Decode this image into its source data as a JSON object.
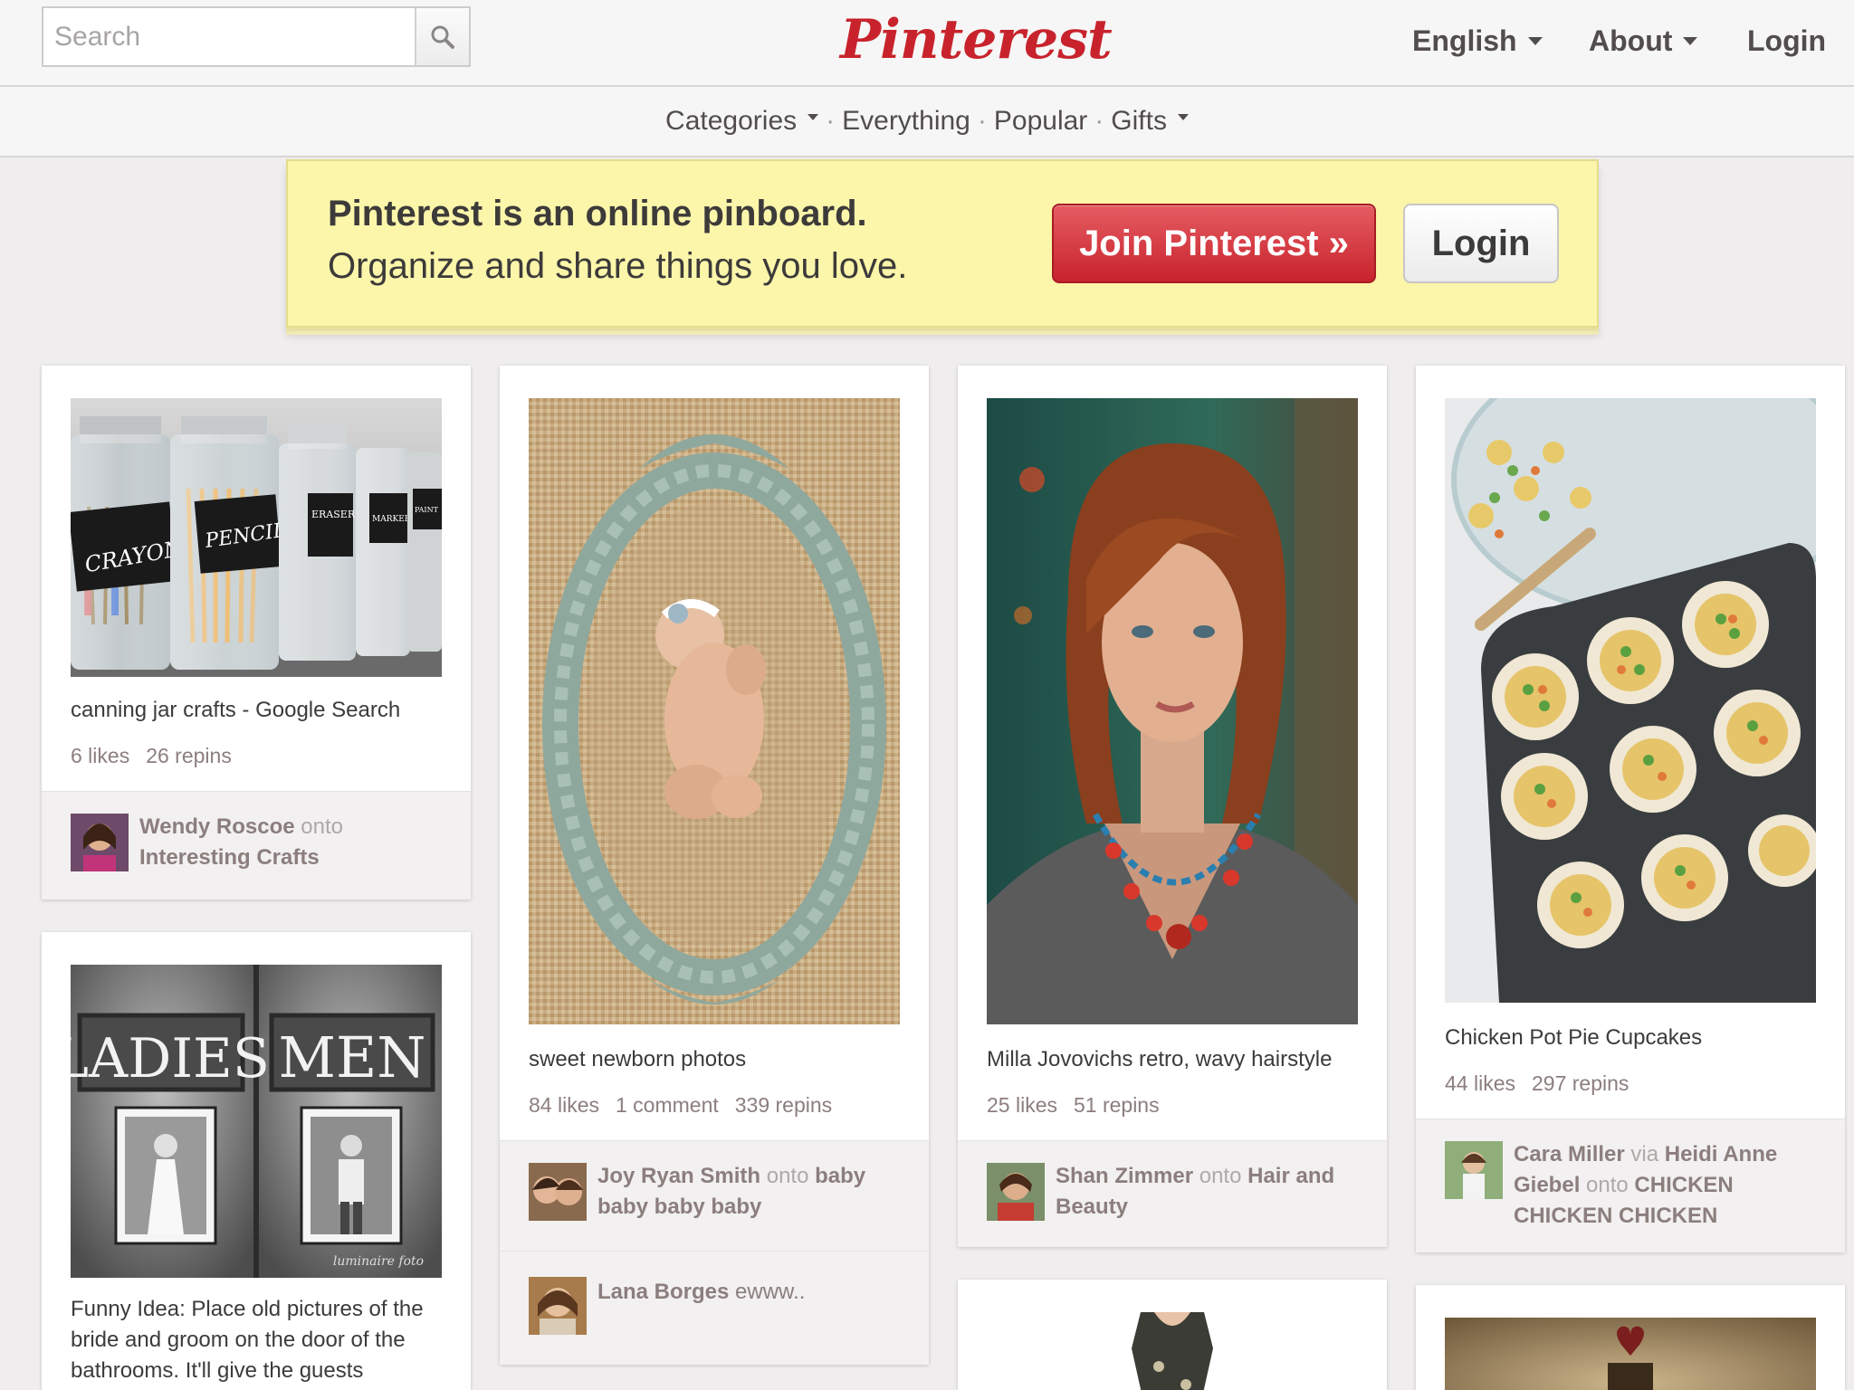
{
  "header": {
    "search_placeholder": "Search",
    "logo": "Pinterest",
    "nav": [
      "English",
      "About",
      "Login"
    ]
  },
  "subnav": {
    "items": [
      "Categories",
      "Everything",
      "Popular",
      "Gifts"
    ]
  },
  "banner": {
    "title": "Pinterest is an online pinboard.",
    "subtitle": "Organize and share things you love.",
    "join_label": "Join Pinterest »",
    "login_label": "Login"
  },
  "pins": [
    {
      "description": "canning jar crafts - Google Search",
      "stats": [
        "6 likes",
        "26 repins"
      ],
      "jar_labels": [
        "CRAYONS",
        "PENCILS",
        "ERASERS SANDS",
        "MARKERS",
        "PAINT"
      ],
      "attribution": [
        {
          "user": "Wendy Roscoe",
          "joiner": "onto",
          "board": "Interesting Crafts"
        }
      ]
    },
    {
      "description": "sweet newborn photos",
      "stats": [
        "84 likes",
        "1 comment",
        "339 repins"
      ],
      "attribution": [
        {
          "user": "Joy Ryan Smith",
          "joiner": "onto",
          "board": "baby baby baby baby"
        },
        {
          "user": "Lana Borges",
          "comment": "ewww.."
        }
      ]
    },
    {
      "description": "Milla Jovovichs retro, wavy hairstyle",
      "stats": [
        "25 likes",
        "51 repins"
      ],
      "attribution": [
        {
          "user": "Shan Zimmer",
          "joiner": "onto",
          "board": "Hair and Beauty"
        }
      ]
    },
    {
      "description": "Chicken Pot Pie Cupcakes",
      "stats": [
        "44 likes",
        "297 repins"
      ],
      "attribution": [
        {
          "user": "Cara Miller",
          "via_joiner": "via",
          "via": "Heidi Anne Giebel",
          "joiner": "onto",
          "board": "CHICKEN CHICKEN CHICKEN"
        }
      ]
    },
    {
      "description": "Funny Idea: Place old pictures of the bride and groom on the door of the bathrooms. It'll give the guests",
      "sign_left": "LADIES",
      "sign_right": "MEN",
      "watermark": "luminaire foto"
    }
  ]
}
